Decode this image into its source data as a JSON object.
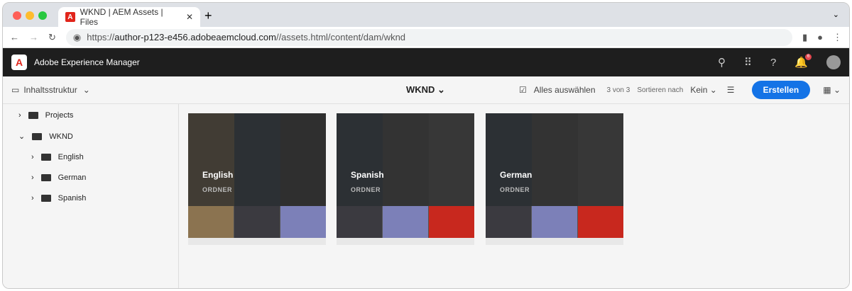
{
  "browser": {
    "tab_title": "WKND | AEM Assets | Files",
    "url_host": "author-p123-e456.adobeaemcloud.com",
    "url_path": "//assets.html/content/dam/wknd",
    "url_scheme": "https://"
  },
  "header": {
    "title": "Adobe Experience Manager",
    "notification_count": "6"
  },
  "toolbar": {
    "rail_label": "Inhaltsstruktur",
    "folder_title": "WKND",
    "select_all": "Alles auswählen",
    "count": "3 von 3",
    "sort_label": "Sortieren nach",
    "sort_value": "Kein",
    "create": "Erstellen"
  },
  "tree": [
    {
      "label": "Projects"
    },
    {
      "label": "WKND"
    },
    {
      "label": "English"
    },
    {
      "label": "German"
    },
    {
      "label": "Spanish"
    }
  ],
  "cards": [
    {
      "title": "English",
      "type": "ORDNER"
    },
    {
      "title": "Spanish",
      "type": "ORDNER"
    },
    {
      "title": "German",
      "type": "ORDNER"
    }
  ]
}
